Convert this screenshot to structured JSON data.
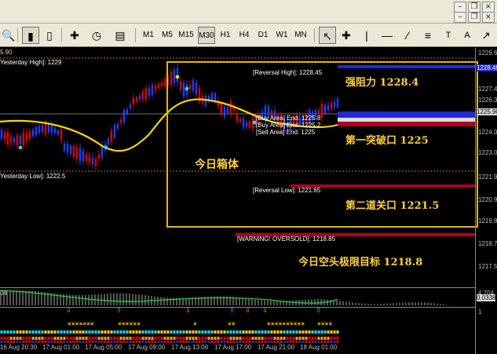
{
  "toolbar": {
    "timeframes": [
      "M1",
      "M5",
      "M15",
      "M30",
      "H1",
      "H4",
      "D1",
      "W1",
      "MN"
    ],
    "active_timeframe": "M30",
    "tools": [
      "T",
      "A"
    ]
  },
  "levels": {
    "yesterday_high": "Yesterday High]: 1229",
    "yesterday_low": "Yesterday Low]: 1222.5",
    "reversal_high": "[Reversal High]: 1228.45",
    "reversal_low": "[Reversal Low]: 1221.65",
    "oversold": "[WARNING! OVERSOLD]: 1218.85",
    "buy_area": "[Buy Area] End: 1225.8",
    "buy_area_2": "[Buy Area] End: 1225.2",
    "sell_area": "[Sell Area] End: 1225",
    "top_left_value": "5.90"
  },
  "annotations": {
    "resistance": "强阻力 1228.4",
    "first_break": "第一突破口 1225",
    "box_label": "今日箱体",
    "second_gate": "第二道关口 1221.5",
    "short_target": "今日空头极限目标 1218.8"
  },
  "indicator": {
    "left_value": "04",
    "right_value": "4.704",
    "right_value_2": "0.0338"
  },
  "signal_panel": {
    "right_value": "1"
  },
  "price_axis": [
    "1229.60",
    "1228.45",
    "1227.40",
    "1226.30",
    "1225.90",
    "1224.00",
    "1223.00",
    "1221.90",
    "1220.90",
    "1219.80",
    "1218.70",
    "1217.50"
  ],
  "time_axis": [
    "16 Aug 20:30",
    "17 Aug 01:00",
    "17 Aug 05:00",
    "17 Aug 09:00",
    "17 Aug 13:00",
    "17 Aug 17:00",
    "17 Aug 21:00",
    "18 Aug 01:00"
  ],
  "colors": {
    "up": "#1e40ff",
    "down": "#e00000",
    "ma": "#ffd400",
    "ma2": "#2ed0ff",
    "box": "#e6b800"
  }
}
